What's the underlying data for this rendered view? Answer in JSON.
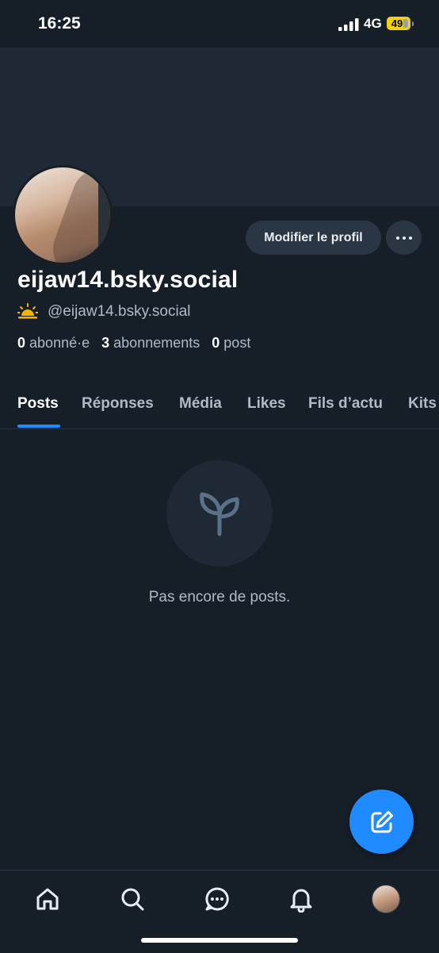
{
  "status_bar": {
    "time": "16:25",
    "network": "4G",
    "battery": "49"
  },
  "profile": {
    "display_name": "eijaw14.bsky.social",
    "handle": "@eijaw14.bsky.social",
    "edit_label": "Modifier le profil",
    "stats": {
      "followers_count": "0",
      "followers_label": "abonné·e",
      "following_count": "3",
      "following_label": "abonnements",
      "posts_count": "0",
      "posts_label": "post"
    }
  },
  "tabs": [
    {
      "label": "Posts",
      "active": true
    },
    {
      "label": "Réponses"
    },
    {
      "label": "Média"
    },
    {
      "label": "Likes"
    },
    {
      "label": "Fils d’actu"
    },
    {
      "label": "Kits"
    }
  ],
  "empty_state": {
    "icon": "seedling-icon",
    "text": "Pas encore de posts."
  },
  "fab": {
    "icon": "compose-icon"
  },
  "bottom_nav": [
    {
      "icon": "home-icon"
    },
    {
      "icon": "search-icon"
    },
    {
      "icon": "chat-icon"
    },
    {
      "icon": "bell-icon"
    },
    {
      "icon": "avatar"
    }
  ],
  "colors": {
    "background": "#161e27",
    "banner": "#1e2935",
    "accent": "#208bfe",
    "muted_text": "#aebbc9",
    "button_bg": "#2a3643"
  }
}
